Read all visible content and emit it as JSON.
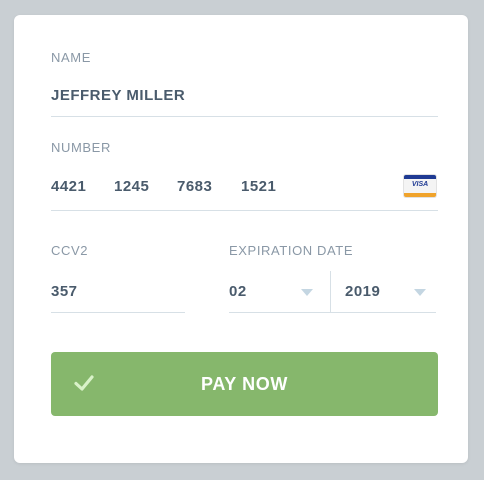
{
  "form": {
    "name_label": "NAME",
    "name_value": "JEFFREY MILLER",
    "number_label": "NUMBER",
    "number_groups": [
      "4421",
      "1245",
      "7683",
      "1521"
    ],
    "card_brand": "VISA",
    "ccv_label": "CCV2",
    "ccv_value": "357",
    "expiration_label": "EXPIRATION DATE",
    "expiration_month": "02",
    "expiration_year": "2019"
  },
  "button": {
    "label": "PAY NOW",
    "icon": "check-icon",
    "color": "#86b76c"
  },
  "colors": {
    "background": "#c9cfd3",
    "card": "#ffffff",
    "label": "#8a98a6",
    "value": "#4a5b6c",
    "divider": "#d7e0e6",
    "caret": "#c4d6e2"
  }
}
